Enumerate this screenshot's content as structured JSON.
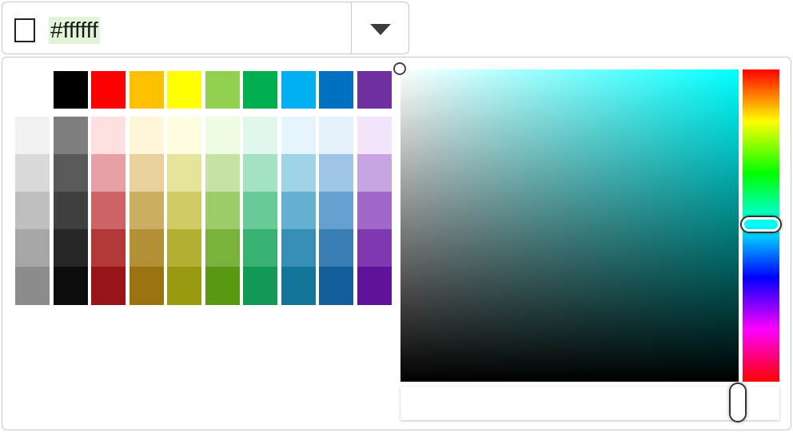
{
  "color_input": {
    "value": "#ffffff",
    "preview_color": "#ffffff",
    "dropdown_icon": "caret-down-icon"
  },
  "palette": {
    "top_row": [
      "#ffffff",
      "#000000",
      "#ff0000",
      "#ffc000",
      "#ffff00",
      "#92d050",
      "#00b050",
      "#00b0f0",
      "#0070c0",
      "#7030a0"
    ],
    "shade_rows": [
      [
        "#f2f2f2",
        "#7f7f7f",
        "#ffe0e0",
        "#fff5d9",
        "#fffde0",
        "#f0fbe3",
        "#e3f8ec",
        "#e6f5fd",
        "#e4f0fa",
        "#f2e4fb"
      ],
      [
        "#d9d9d9",
        "#595959",
        "#e6a0a6",
        "#e8d19c",
        "#e6e49a",
        "#c6e3a6",
        "#a3e2c2",
        "#9fd3e8",
        "#9fc6e8",
        "#c8a4e3"
      ],
      [
        "#bfbfbf",
        "#404040",
        "#cc6466",
        "#ccae63",
        "#cfcb65",
        "#9dcc6b",
        "#66c996",
        "#66b0d1",
        "#66a0d0",
        "#a066c8"
      ],
      [
        "#a6a6a6",
        "#262626",
        "#b33838",
        "#b38f35",
        "#b3b034",
        "#7ab33b",
        "#38b072",
        "#388fb5",
        "#387db3",
        "#8038b0"
      ],
      [
        "#8c8c8c",
        "#0d0d0d",
        "#99131a",
        "#99730f",
        "#99990f",
        "#599913",
        "#139956",
        "#137599",
        "#135d99",
        "#601399"
      ]
    ]
  },
  "picker": {
    "hue_color": "#00ffff",
    "hue_degrees": 180,
    "saturation": 0,
    "brightness": 1,
    "alpha": 1
  }
}
